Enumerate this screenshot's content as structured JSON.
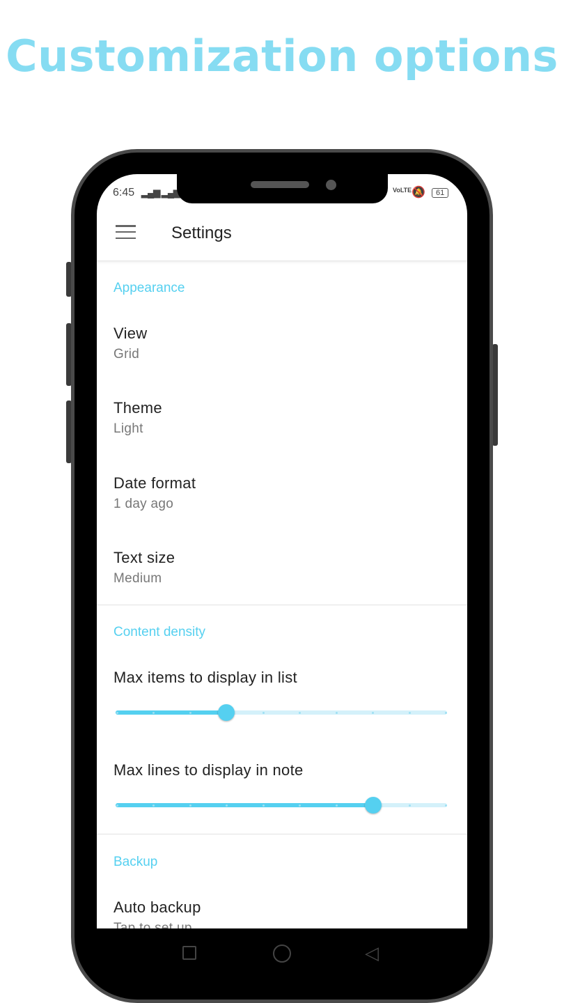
{
  "headline": "Customization options",
  "status": {
    "time": "6:45",
    "network": "VoLTE",
    "battery": "61"
  },
  "appbar": {
    "title": "Settings"
  },
  "sections": [
    {
      "title": "Appearance",
      "items": [
        {
          "title": "View",
          "value": "Grid"
        },
        {
          "title": "Theme",
          "value": "Light"
        },
        {
          "title": "Date format",
          "value": "1 day ago"
        },
        {
          "title": "Text size",
          "value": "Medium"
        }
      ]
    },
    {
      "title": "Content density",
      "sliders": [
        {
          "label": "Max items to display in list",
          "steps": 9,
          "value": 3
        },
        {
          "label": "Max lines to display in note",
          "steps": 9,
          "value": 7
        }
      ]
    },
    {
      "title": "Backup",
      "items": [
        {
          "title": "Auto backup",
          "value": "Tap to set up"
        }
      ]
    }
  ],
  "colors": {
    "accent": "#55d0f0",
    "headline": "#86dcf2"
  }
}
